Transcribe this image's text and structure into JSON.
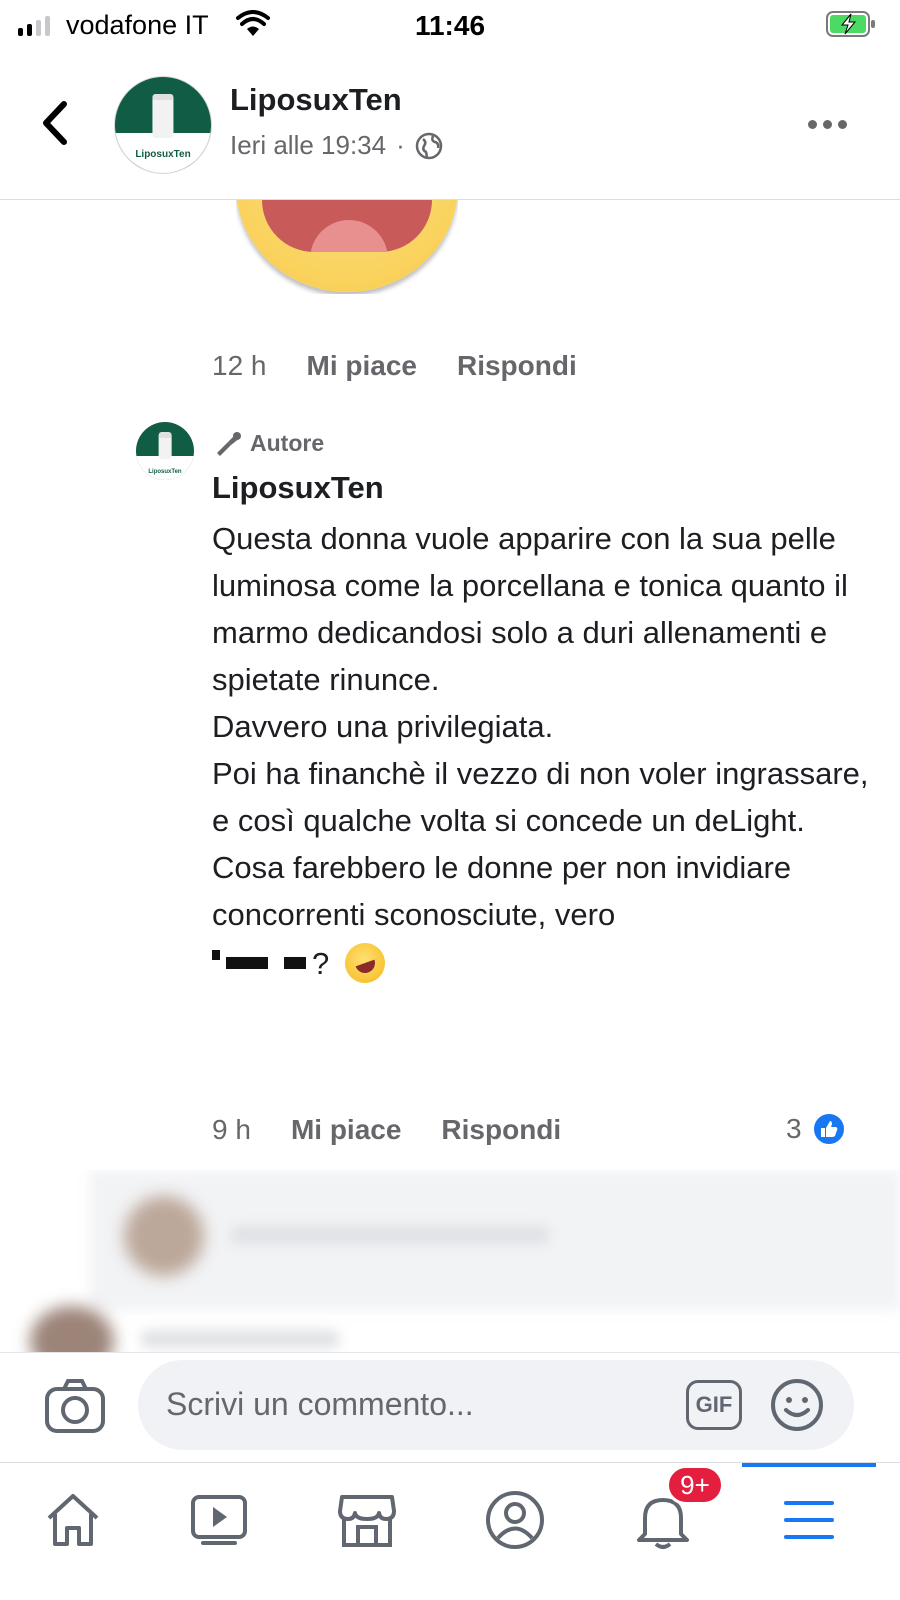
{
  "status_bar": {
    "carrier": "vodafone IT",
    "time": "11:46",
    "signal_bars_active": 2,
    "signal_bars_total": 4,
    "battery_state": "charging"
  },
  "header": {
    "page_name": "LiposuxTen",
    "timestamp": "Ieri alle 19:34",
    "separator": "·",
    "privacy_icon": "globe-icon",
    "avatar_label": "LiposuxTen"
  },
  "previous_comment": {
    "time": "12 h",
    "like_label": "Mi piace",
    "reply_label": "Rispondi"
  },
  "comment": {
    "badge": "Autore",
    "badge_icon": "megaphone-icon",
    "author": "LiposuxTen",
    "avatar_label": "LiposuxTen",
    "lines": [
      "Questa donna vuole apparire con la sua pelle luminosa come la porcellana e tonica quanto il marmo dedicandosi solo a duri allenamenti e spietate rinunce.",
      "Davvero una privilegiata.",
      "Poi ha financhè il vezzo di non voler ingrassare, e così qualche volta si concede un deLight.",
      "Cosa farebbero le donne per non invidiare concorrenti sconosciute, vero"
    ],
    "tail_text": "?",
    "tail_emoji": "rolling-on-floor-laughing",
    "time": "9 h",
    "like_label": "Mi piace",
    "reply_label": "Rispondi",
    "reaction_count": "3",
    "reaction_icon": "like-icon"
  },
  "composer": {
    "placeholder": "Scrivi un commento...",
    "gif_label": "GIF"
  },
  "tabbar": {
    "tabs": [
      "home-icon",
      "video-icon",
      "marketplace-icon",
      "profile-icon",
      "notifications-icon",
      "menu-icon"
    ],
    "notification_badge": "9+",
    "active_tab": "menu-icon"
  },
  "colors": {
    "brand_green": "#115c45",
    "facebook_blue": "#1877f2",
    "badge_red": "#e41e3f",
    "secondary_text": "#65676b"
  }
}
